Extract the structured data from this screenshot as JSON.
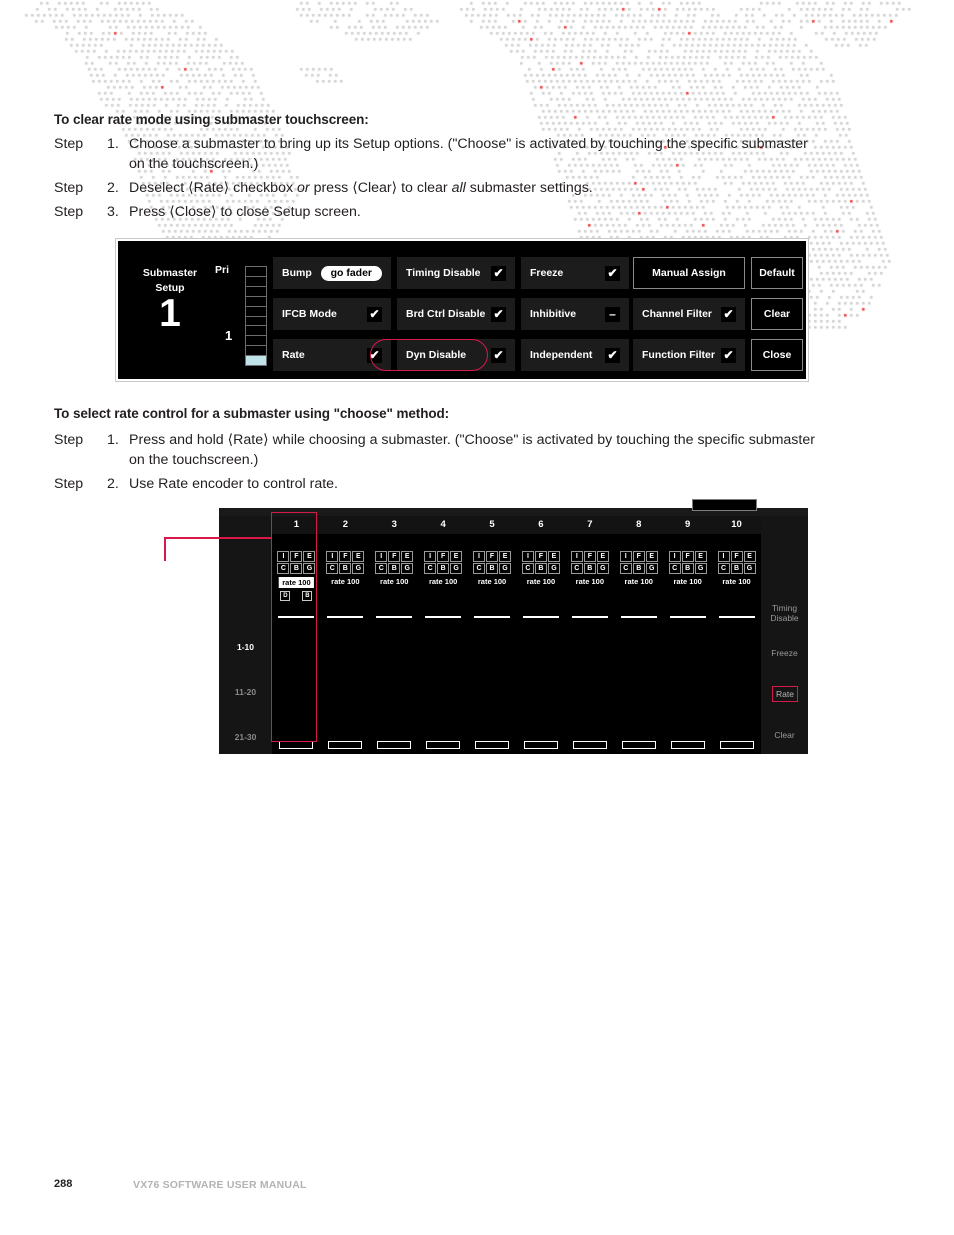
{
  "sections": [
    {
      "heading": "To clear rate mode using submaster touchscreen:",
      "steps": [
        {
          "word": "Step",
          "num": "1.",
          "text_html": "Choose a submaster to bring up its Setup options. (\"Choose\" is activated by touching the specific submaster on the touchscreen.)"
        },
        {
          "word": "Step",
          "num": "2.",
          "text_html": "Deselect ⟨Rate⟩ checkbox <span class=\"it\">or</span> press ⟨Clear⟩ to clear <span class=\"it\">all</span> submaster settings."
        },
        {
          "word": "Step",
          "num": "3.",
          "text_html": "Press ⟨Close⟩ to close Setup screen."
        }
      ]
    },
    {
      "heading": "To select rate control for a submaster using \"choose\" method:",
      "steps": [
        {
          "word": "Step",
          "num": "1.",
          "text_html": "Press and hold ⟨Rate⟩ while choosing a submaster. (\"Choose\" is activated by touching the specific submaster on the touchscreen.)"
        },
        {
          "word": "Step",
          "num": "2.",
          "text_html": "Use Rate encoder to control rate."
        }
      ]
    }
  ],
  "submaster_setup": {
    "title_line1": "Submaster",
    "title_line2": "Setup",
    "number": "1",
    "pri_label": "Pri",
    "pri_value": "1",
    "pri_segments": 10,
    "pri_filled": 1,
    "buttons": [
      {
        "label": "Bump",
        "state": "pill",
        "pill": "go fader",
        "style": "fill"
      },
      {
        "label": "Timing Disable",
        "state": "check",
        "style": "fill"
      },
      {
        "label": "Freeze",
        "state": "check",
        "style": "fill"
      },
      {
        "label": "Manual Assign",
        "state": "none",
        "style": "outline"
      },
      {
        "label": "Default",
        "state": "none",
        "style": "outline"
      },
      {
        "label": "IFCB Mode",
        "state": "check",
        "style": "fill"
      },
      {
        "label": "Brd Ctrl Disable",
        "state": "check",
        "style": "fill"
      },
      {
        "label": "Inhibitive",
        "state": "dash",
        "style": "fill"
      },
      {
        "label": "Channel Filter",
        "state": "check",
        "style": "fill"
      },
      {
        "label": "Clear",
        "state": "none",
        "style": "outline"
      },
      {
        "label": "Rate",
        "state": "check",
        "style": "fill",
        "highlight": true
      },
      {
        "label": "Dyn Disable",
        "state": "check",
        "style": "fill"
      },
      {
        "label": "Independent",
        "state": "check",
        "style": "fill"
      },
      {
        "label": "Function Filter",
        "state": "check",
        "style": "fill"
      },
      {
        "label": "Close",
        "state": "none",
        "style": "outline"
      }
    ],
    "check_glyph": "✔",
    "dash_glyph": "–"
  },
  "submaster_grid": {
    "columns": [
      "1",
      "2",
      "3",
      "4",
      "5",
      "6",
      "7",
      "8",
      "9",
      "10"
    ],
    "cell_letters_row1": [
      "I",
      "F",
      "E"
    ],
    "cell_letters_row2": [
      "C",
      "B",
      "G"
    ],
    "rate_text": "rate 100",
    "selected_column": "1",
    "selected_extra_boxes": [
      "D",
      "B"
    ],
    "page_buttons": [
      {
        "label": "1-10",
        "active": true
      },
      {
        "label": "11-20",
        "active": false
      },
      {
        "label": "21-30",
        "active": false
      }
    ],
    "side_buttons": [
      {
        "label": "Timing\nDisable",
        "boxed": false
      },
      {
        "label": "Freeze",
        "boxed": false
      },
      {
        "label": "Rate",
        "boxed": true
      },
      {
        "label": "Clear",
        "boxed": false
      }
    ],
    "accent_color": "#d6194b"
  },
  "footer": {
    "page_number": "288",
    "manual_title": "VX76 SOFTWARE USER MANUAL"
  }
}
